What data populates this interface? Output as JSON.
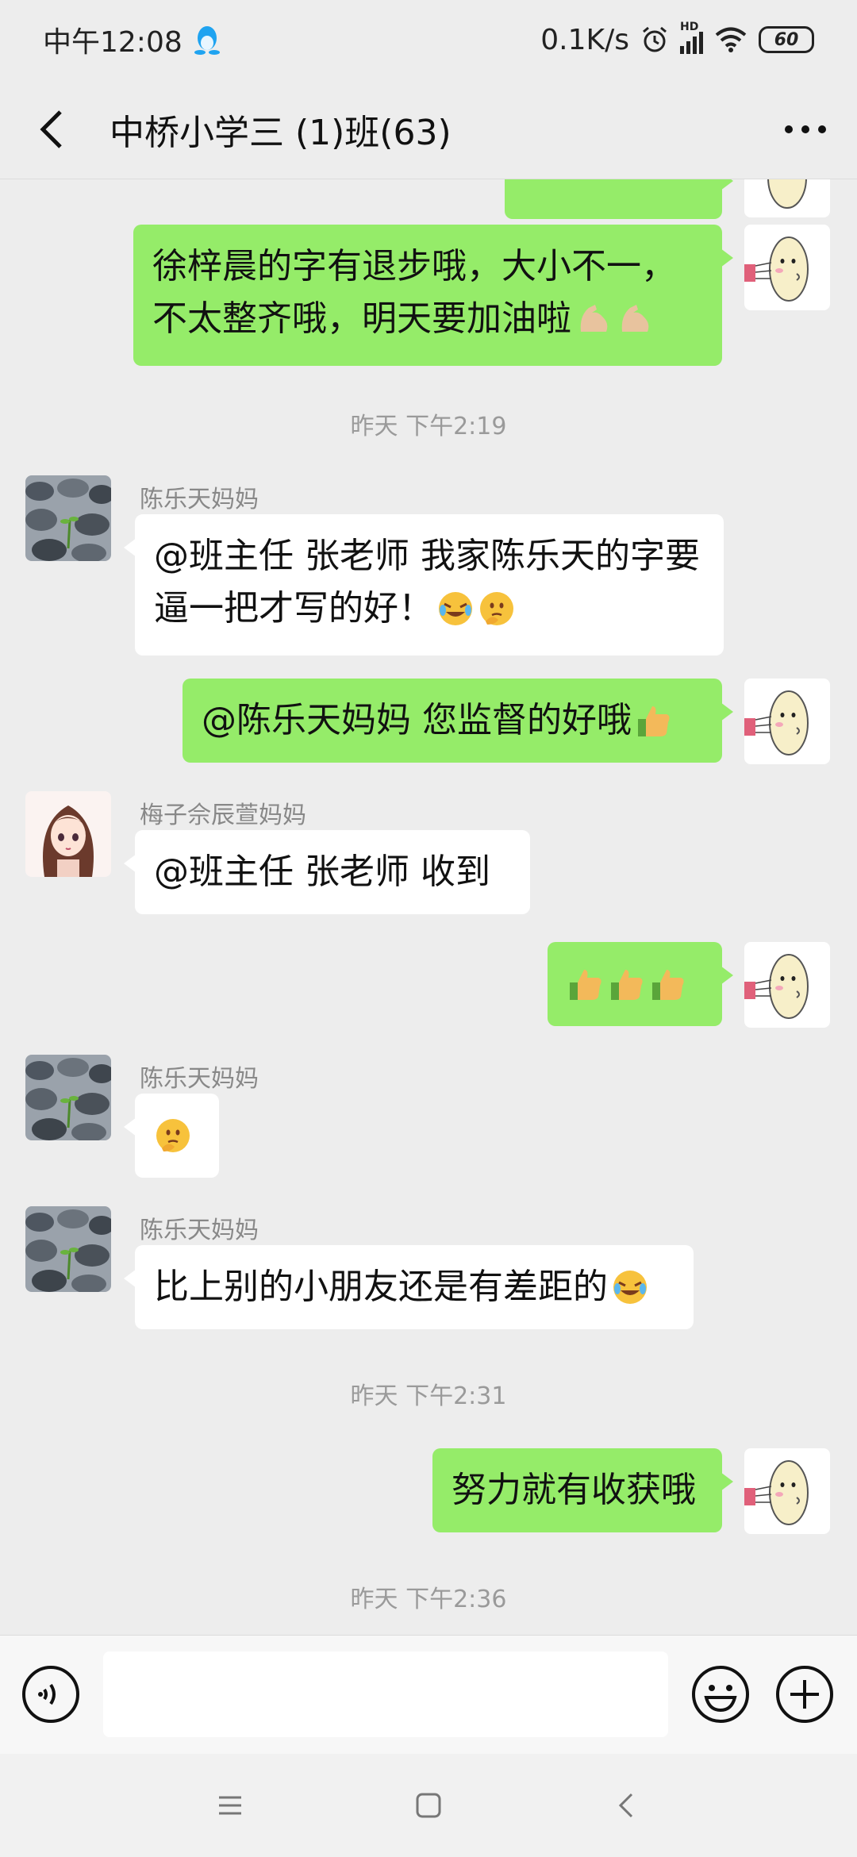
{
  "status_bar": {
    "time": "中午12:08",
    "net_speed": "0.1K/s",
    "battery": "60",
    "network_label": "HD"
  },
  "header": {
    "title": "中桥小学三 (1)班(63)"
  },
  "messages": {
    "m1": {
      "text": "徐梓晨的字有退步哦，大小不一，不太整齐哦，明天要加油啦",
      "emoji": "flexed-biceps x2"
    },
    "ts1": "昨天 下午2:19",
    "m2": {
      "sender": "陈乐天妈妈",
      "text": "@班主任 张老师  我家陈乐天的字要逼一把才写的好！",
      "emoji": "crying-laughing, thinking-face"
    },
    "m3": {
      "text": "@陈乐天妈妈  您监督的好哦",
      "emoji": "thumbs-up"
    },
    "m4": {
      "sender": "梅子佘辰萱妈妈",
      "text": "@班主任 张老师  收到"
    },
    "m5": {
      "emoji": "thumbs-up x3"
    },
    "m6": {
      "sender": "陈乐天妈妈",
      "emoji": "thinking-face"
    },
    "m7": {
      "sender": "陈乐天妈妈",
      "text": "比上别的小朋友还是有差距的",
      "emoji": "crying-laughing"
    },
    "ts2": "昨天 下午2:31",
    "m8": {
      "text": "努力就有收获哦"
    },
    "ts3": "昨天 下午2:36"
  },
  "input": {
    "placeholder": "",
    "value": ""
  },
  "colors": {
    "outgoing_bubble": "#95ec69",
    "incoming_bubble": "#ffffff",
    "background": "#ededed",
    "timestamp": "#9a9a9a"
  }
}
